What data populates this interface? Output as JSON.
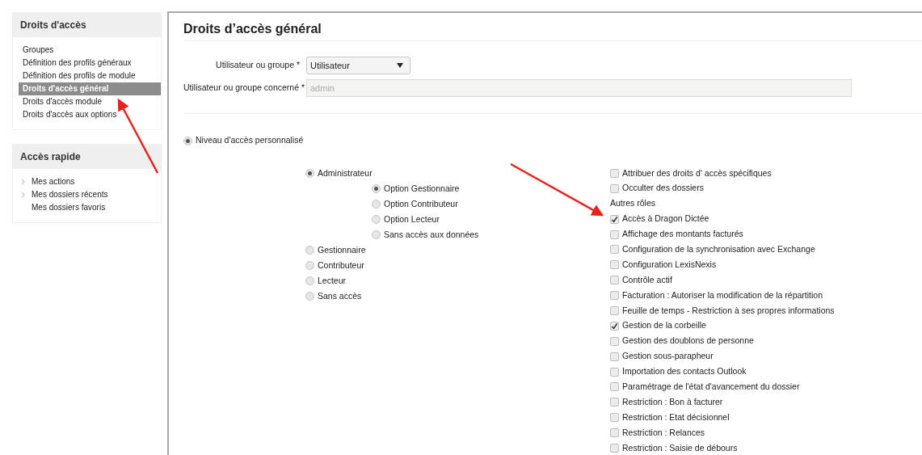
{
  "sidebar": {
    "sections": [
      {
        "title": "Droits d'accès",
        "items": [
          {
            "label": "Groupes",
            "selected": false,
            "expandable": false
          },
          {
            "label": "Définition des profils généraux",
            "selected": false,
            "expandable": false
          },
          {
            "label": "Définition des profils de module",
            "selected": false,
            "expandable": false
          },
          {
            "label": "Droits d'accès général",
            "selected": true,
            "expandable": false
          },
          {
            "label": "Droits d'accès module",
            "selected": false,
            "expandable": false
          },
          {
            "label": "Droits d'accès aux options",
            "selected": false,
            "expandable": false
          }
        ]
      },
      {
        "title": "Accès rapide",
        "items": [
          {
            "label": "Mes actions",
            "selected": false,
            "expandable": true
          },
          {
            "label": "Mes dossiers récents",
            "selected": false,
            "expandable": true
          },
          {
            "label": "Mes dossiers favoris",
            "selected": false,
            "expandable": false
          }
        ]
      }
    ]
  },
  "panel": {
    "title": "Droits d’accès général",
    "form": {
      "user_or_group": {
        "label": "Utilisateur ou groupe *",
        "value": "Utilisateur"
      },
      "concerned": {
        "label": "Utilisateur ou groupe concerné *",
        "value": "admin",
        "disabled": true
      }
    },
    "access_level": {
      "label": "Niveau d'accès personnalisé",
      "selected": true
    },
    "roles": [
      {
        "label": "Administrateur",
        "selected": true,
        "children": [
          {
            "label": "Option Gestionnaire",
            "selected": true
          },
          {
            "label": "Option Contributeur",
            "selected": false
          },
          {
            "label": "Option Lecteur",
            "selected": false
          },
          {
            "label": "Sans accès aux données",
            "selected": false
          }
        ]
      },
      {
        "label": "Gestionnaire",
        "selected": false
      },
      {
        "label": "Contributeur",
        "selected": false
      },
      {
        "label": "Lecteur",
        "selected": false
      },
      {
        "label": "Sans accès",
        "selected": false
      }
    ],
    "options": [
      {
        "kind": "checkbox",
        "label": "Attribuer des droits d' accès spécifiques",
        "checked": false
      },
      {
        "kind": "checkbox",
        "label": "Occulter des dossiers",
        "checked": false
      },
      {
        "kind": "heading",
        "label": "Autres rôles"
      },
      {
        "kind": "checkbox",
        "label": "Accès à Dragon Dictée",
        "checked": true
      },
      {
        "kind": "checkbox",
        "label": "Affichage des montants facturés",
        "checked": false
      },
      {
        "kind": "checkbox",
        "label": "Configuration de la synchronisation avec Exchange",
        "checked": false
      },
      {
        "kind": "checkbox",
        "label": "Configuration LexisNexis",
        "checked": false
      },
      {
        "kind": "checkbox",
        "label": "Contrôle actif",
        "checked": false
      },
      {
        "kind": "checkbox",
        "label": "Facturation : Autoriser la modification de la répartition",
        "checked": false
      },
      {
        "kind": "checkbox",
        "label": "Feuille de temps - Restriction à ses propres informations",
        "checked": false
      },
      {
        "kind": "checkbox",
        "label": "Gestion de la corbeille",
        "checked": true
      },
      {
        "kind": "checkbox",
        "label": "Gestion des doublons de personne",
        "checked": false
      },
      {
        "kind": "checkbox",
        "label": "Gestion sous-parapheur",
        "checked": false
      },
      {
        "kind": "checkbox",
        "label": "Importation des contacts Outlook",
        "checked": false
      },
      {
        "kind": "checkbox",
        "label": "Paramétrage de l'état d'avancement du dossier",
        "checked": false
      },
      {
        "kind": "checkbox",
        "label": "Restriction : Bon à facturer",
        "checked": false
      },
      {
        "kind": "checkbox",
        "label": "Restriction : Etat décisionnel",
        "checked": false
      },
      {
        "kind": "checkbox",
        "label": "Restriction : Relances",
        "checked": false
      },
      {
        "kind": "checkbox",
        "label": "Restriction : Saisie de débours",
        "checked": false
      }
    ]
  }
}
